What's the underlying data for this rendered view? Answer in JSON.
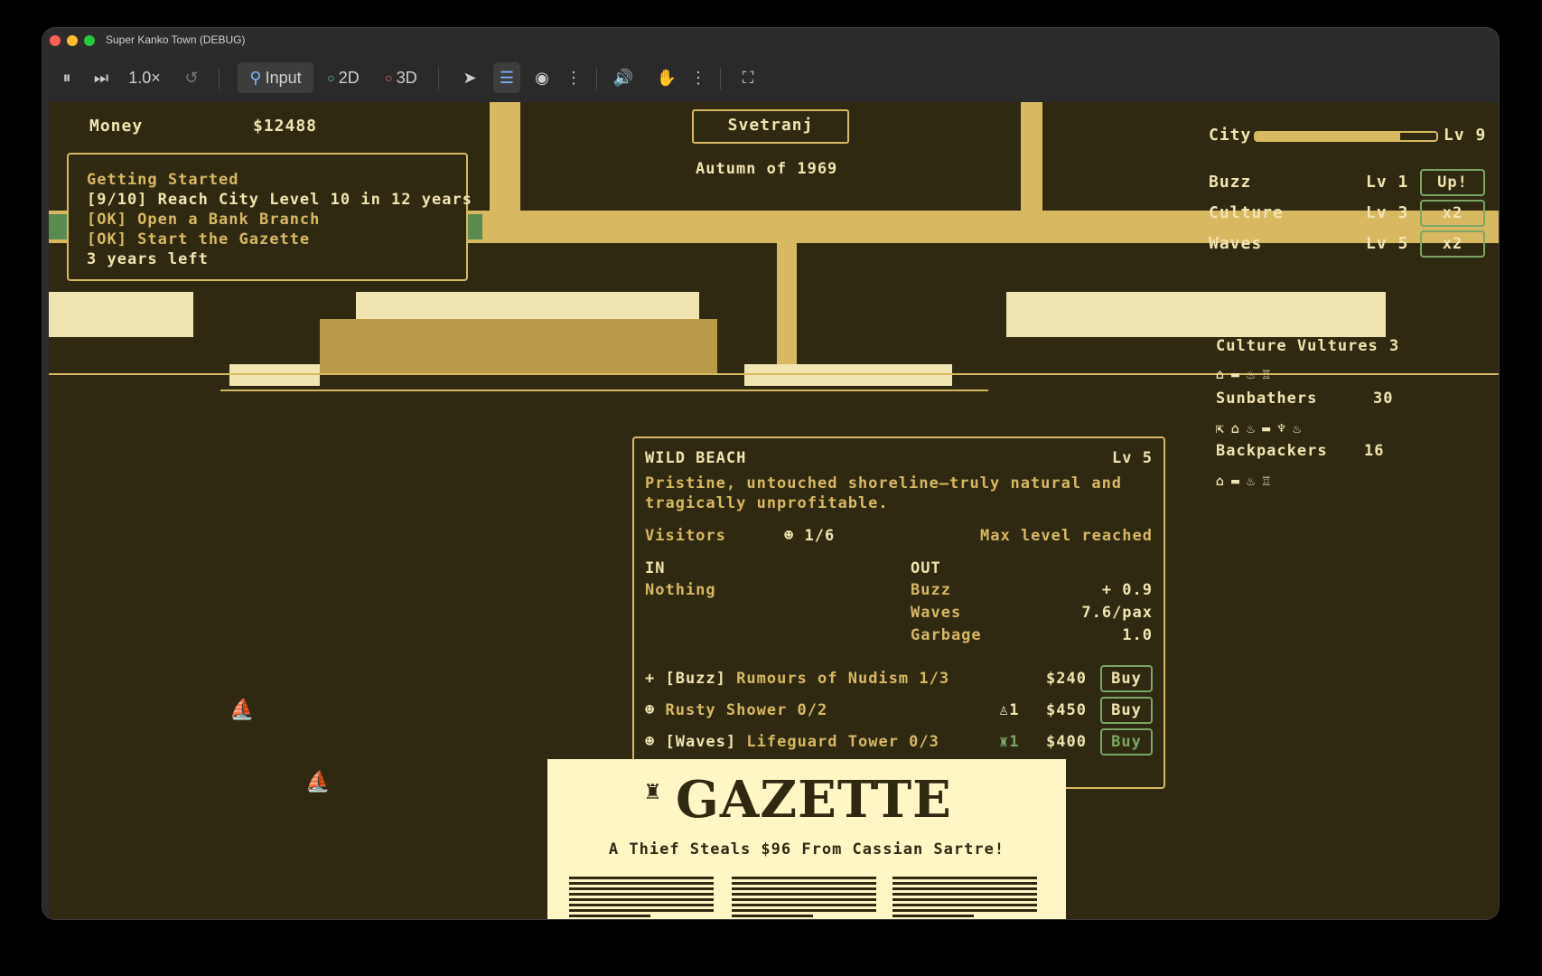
{
  "window": {
    "title": "Super Kanko Town (DEBUG)"
  },
  "toolbar": {
    "speed": "1.0×",
    "input": "Input",
    "mode2d": "2D",
    "mode3d": "3D"
  },
  "hud": {
    "money_label": "Money",
    "money_value": "$12488",
    "town_name": "Svetranj",
    "season": "Autumn of 1969"
  },
  "quest": {
    "title": "Getting Started",
    "lines": [
      "[9/10] Reach City Level 10 in 12 years",
      "[OK] Open a Bank Branch",
      "[OK] Start the Gazette",
      "3 years left"
    ]
  },
  "stats": {
    "city_label": "City",
    "city_level": "Lv 9",
    "city_progress": 0.8,
    "rows": [
      {
        "label": "Buzz",
        "level": "Lv 1",
        "btn": "Up!"
      },
      {
        "label": "Culture",
        "level": "Lv 3",
        "btn": "x2"
      },
      {
        "label": "Waves",
        "level": "Lv 5",
        "btn": "x2"
      }
    ]
  },
  "visitors": [
    {
      "name": "Culture Vultures",
      "count": "3"
    },
    {
      "name": "Sunbathers",
      "count": "30"
    },
    {
      "name": "Backpackers",
      "count": "16"
    }
  ],
  "beach": {
    "name": "WILD BEACH",
    "level": "Lv 5",
    "desc1": "Pristine, untouched shoreline—truly natural and",
    "desc2": "tragically unprofitable.",
    "visitors_label": "Visitors",
    "visitors_value": "1/6",
    "max_label": "Max level reached",
    "in_label": "IN",
    "in_value": "Nothing",
    "out_label": "OUT",
    "out": [
      {
        "name": "Buzz",
        "value": "+ 0.9"
      },
      {
        "name": "Waves",
        "value": "7.6/pax"
      },
      {
        "name": "Garbage",
        "value": "1.0"
      }
    ],
    "upgrades": [
      {
        "tag": "+ [Buzz]",
        "name": "Rumours of Nudism 1/3",
        "req": "",
        "price": "$240",
        "btn": "Buy",
        "enabled": true
      },
      {
        "tag": "",
        "name": "Rusty Shower 0/2",
        "req": "1",
        "price": "$450",
        "btn": "Buy",
        "enabled": true
      },
      {
        "tag": "[Waves]",
        "name": "Lifeguard Tower 0/3",
        "req": "1",
        "price": "$400",
        "btn": "Buy",
        "enabled": false
      }
    ]
  },
  "gazette": {
    "title": "GAZETTE",
    "headline": "A Thief Steals $96 From Cassian Sartre!"
  },
  "colors": {
    "bg": "#2f2912",
    "gold": "#d8b861",
    "cream": "#f0e4b0",
    "green": "#5b8c4f"
  }
}
